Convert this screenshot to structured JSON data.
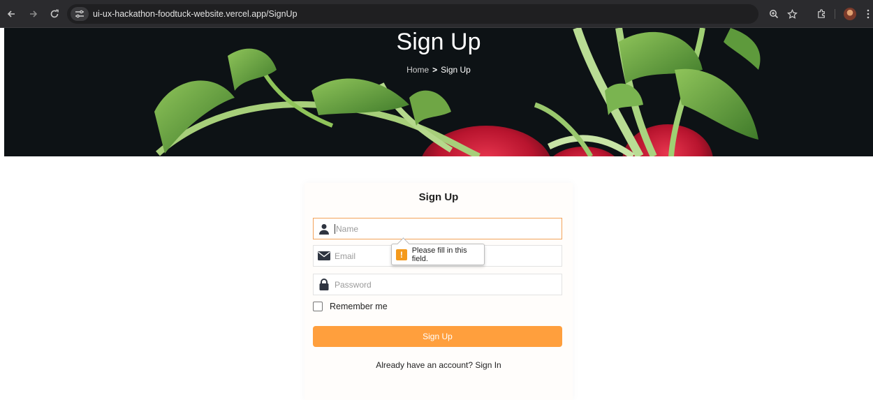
{
  "browser": {
    "url": "ui-ux-hackathon-foodtuck-website.vercel.app/SignUp",
    "icons": [
      "back-arrow-icon",
      "forward-arrow-icon",
      "reload-icon",
      "site-info-icon",
      "zoom-icon",
      "star-icon",
      "extensions-icon",
      "profile-avatar",
      "menu-icon"
    ]
  },
  "hero": {
    "title": "Sign Up",
    "breadcrumb": {
      "home": "Home",
      "separator": ">",
      "current": "Sign Up"
    }
  },
  "form": {
    "title": "Sign Up",
    "name_placeholder": "Name",
    "email_placeholder": "Email",
    "password_placeholder": "Password",
    "remember_label": "Remember me",
    "submit_label": "Sign Up",
    "signin_text": "Already have an account? Sign In"
  },
  "validation": {
    "message": "Please fill in this field.",
    "icon": "!"
  },
  "colors": {
    "accent": "#ff9f3d",
    "focus_border": "#f3a35a",
    "warning": "#f49a1c",
    "hero_bg": "#0d1215"
  }
}
